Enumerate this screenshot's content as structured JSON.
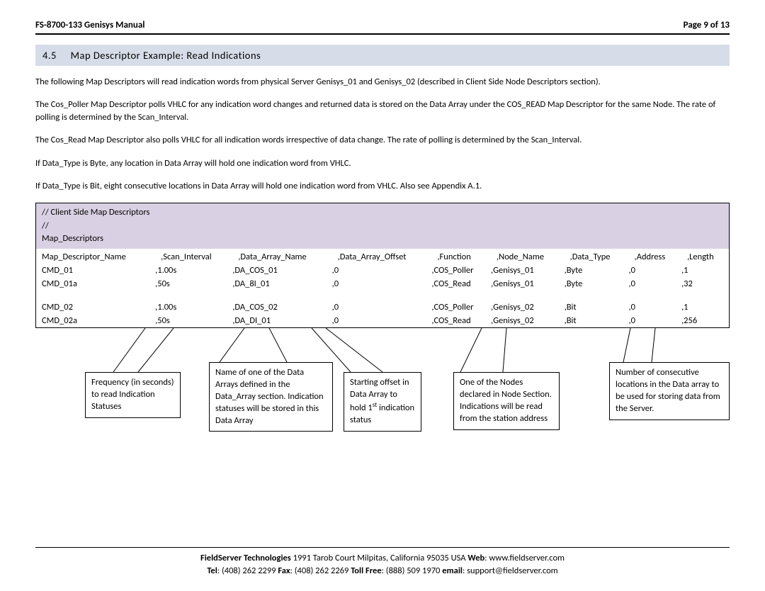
{
  "header": {
    "left": "FS-8700-133 Genisys Manual",
    "right": "Page 9 of 13"
  },
  "section": {
    "number": "4.5",
    "title": "Map Descriptor Example: Read Indications"
  },
  "paragraphs": {
    "p1": "The following Map Descriptors will read indication words from physical Server Genisys_01 and Genisys_02 (described in Client Side Node Descriptors section).",
    "p2": "The Cos_Poller Map Descriptor polls VHLC for any indication word changes and returned data is stored on the Data Array under the COS_READ Map Descriptor for the same Node.  The rate of polling is determined by the Scan_Interval.",
    "p3": "The Cos_Read Map Descriptor also polls VHLC for all indication words irrespective of data change.  The rate of polling is determined by the Scan_Interval.",
    "p4": "If Data_Type is Byte, any location in Data Array will hold one indication word from VHLC.",
    "p5": "If Data_Type is Bit, eight consecutive locations in Data Array will hold one indication word from VHLC. Also see Appendix A.1."
  },
  "table_header": {
    "line1": "//    Client Side Map Descriptors",
    "line2": "//",
    "line3": "Map_Descriptors"
  },
  "table": {
    "columns": [
      "Map_Descriptor_Name",
      ",Scan_Interval",
      ",Data_Array_Name",
      ",Data_Array_Offset",
      ",Function",
      ",Node_Name",
      ",Data_Type",
      ",Address",
      ",Length"
    ],
    "rows": [
      [
        "CMD_01",
        ",1.00s",
        ",DA_COS_01",
        ",0",
        ",COS_Poller",
        ",Genisys_01",
        ",Byte",
        ",0",
        ",1"
      ],
      [
        "CMD_01a",
        ",50s",
        ",DA_8I_01",
        ",0",
        ",COS_Read",
        ",Genisys_01",
        ",Byte",
        ",0",
        ",32"
      ],
      [],
      [
        "CMD_02",
        ",1.00s",
        ",DA_COS_02",
        ",0",
        ",COS_Poller",
        ",Genisys_02",
        ",Bit",
        ",0",
        ",1"
      ],
      [
        "CMD_02a",
        ",50s",
        ",DA_DI_01",
        ",0",
        ",COS_Read",
        ",Genisys_02",
        ",Bit",
        ",0",
        ",256"
      ]
    ]
  },
  "callouts": {
    "c1": "Frequency (in seconds) to read Indication Statuses",
    "c2": "Name of one of the Data Arrays defined in the Data_Array section. Indication statuses will be stored in this Data Array",
    "c3_pre": "Starting offset in Data Array to hold 1",
    "c3_sup": "st",
    "c3_post": " indication status",
    "c4": "One of the Nodes declared in Node Section. Indications will be read from the station address",
    "c5": "Number of consecutive locations in the Data array to be used for storing data from the Server."
  },
  "footer": {
    "line1_b1": "FieldServer Technologies",
    "line1_t1": " 1991 Tarob Court Milpitas, California 95035 USA  ",
    "line1_b2": "Web",
    "line1_t2": ": www.fieldserver.com",
    "line2_b1": "Tel",
    "line2_t1": ": (408) 262 2299  ",
    "line2_b2": "Fax",
    "line2_t2": ": (408) 262 2269  ",
    "line2_b3": "Toll Free",
    "line2_t3": ": (888) 509 1970  ",
    "line2_b4": "email",
    "line2_t4": ": support@fieldserver.com"
  }
}
